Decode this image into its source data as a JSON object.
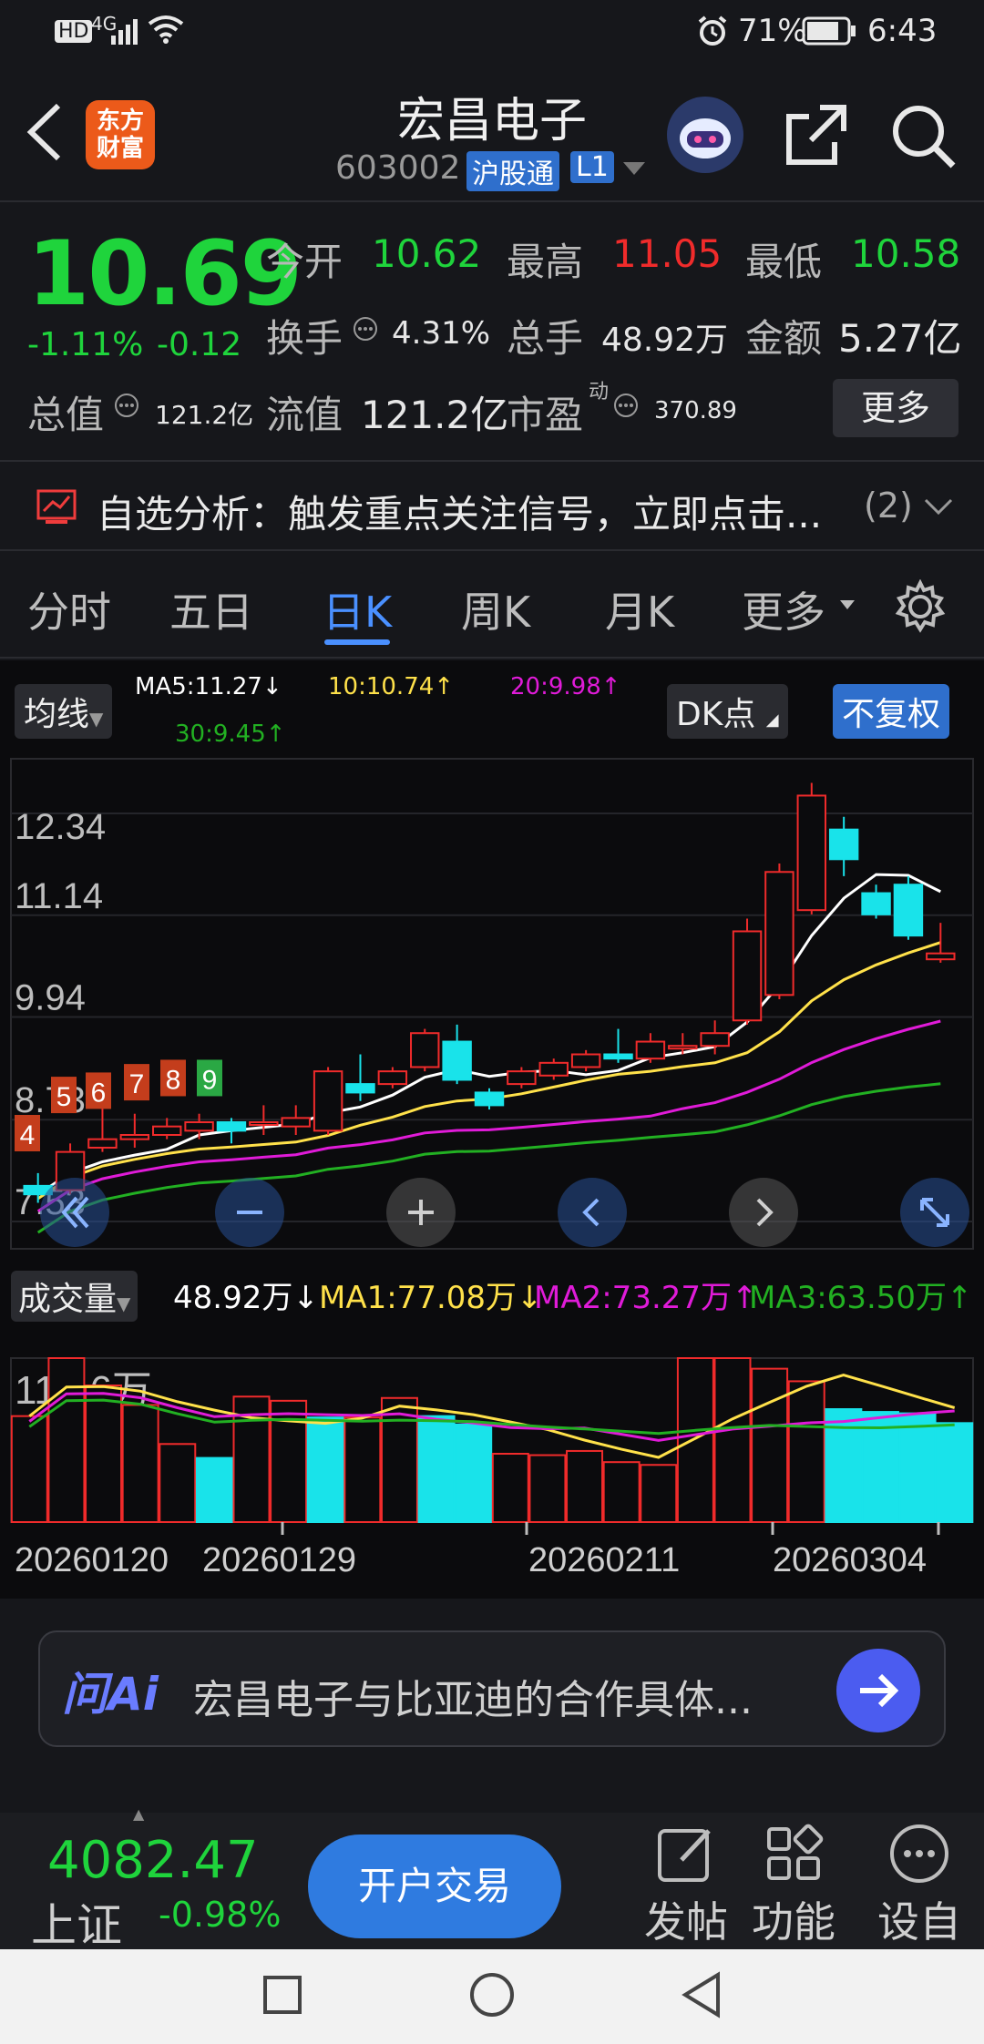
{
  "status": {
    "hd": "HD",
    "net": "4G",
    "battery": "71%",
    "time": "6:43"
  },
  "header": {
    "title": "宏昌电子",
    "code": "603002",
    "badge_connect": "沪股通",
    "badge_level": "L1",
    "logo_line1": "东方",
    "logo_line2": "财富"
  },
  "quote": {
    "price": "10.69",
    "change_pct": "-1.11%",
    "change_abs": "-0.12",
    "open_label": "今开",
    "open": "10.62",
    "high_label": "最高",
    "high": "11.05",
    "low_label": "最低",
    "low": "10.58",
    "turnover_label": "换手",
    "turnover": "4.31%",
    "volume_label": "总手",
    "volume": "48.92万",
    "amount_label": "金额",
    "amount": "5.27亿",
    "mcap_label": "总值",
    "mcap": "121.2亿",
    "float_label": "流值",
    "float": "121.2亿",
    "pe_label": "市盈",
    "pe_sup": "动",
    "pe": "370.89",
    "more": "更多"
  },
  "signal": {
    "text": "自选分析：触发重点关注信号，立即点击...",
    "count": "(2)"
  },
  "tabs": [
    "分时",
    "五日",
    "日K",
    "周K",
    "月K",
    "更多"
  ],
  "active_tab": 2,
  "ma": {
    "label": "均线",
    "ma5": "MA5:11.27↓",
    "ma10": "10:10.74↑",
    "ma20": "20:9.98↑",
    "ma30": "30:9.45↑",
    "dk": "DK点",
    "fq": "不复权"
  },
  "vol": {
    "label": "成交量",
    "v": "48.92万↓",
    "ma1": "MA1:77.08万↓",
    "ma2": "MA2:73.27万↑",
    "ma3": "MA3:63.50万↑"
  },
  "colors": {
    "up": "#f02b2b",
    "down": "#19e3ea",
    "ma5": "#ffffff",
    "ma10": "#ffe14a",
    "ma20": "#e01bd8",
    "ma30": "#22b022"
  },
  "chart_data": {
    "type": "candlestick",
    "price_ticks": [
      "12.34",
      "11.14",
      "9.94",
      "8.73",
      "7.53"
    ],
    "price_range": [
      7.53,
      12.34
    ],
    "volume_max_label": "117.6万",
    "volume_max": 117.6,
    "dates": [
      "20260120",
      "20260129",
      "20260211",
      "20260304"
    ],
    "markers": [
      "4",
      "5",
      "6",
      "7",
      "8",
      "9"
    ],
    "candles": [
      {
        "o": 7.95,
        "c": 7.85,
        "h": 8.1,
        "l": 7.75
      },
      {
        "o": 7.9,
        "c": 8.35,
        "h": 8.45,
        "l": 7.85
      },
      {
        "o": 8.4,
        "c": 8.5,
        "h": 8.9,
        "l": 8.35
      },
      {
        "o": 8.5,
        "c": 8.55,
        "h": 8.8,
        "l": 8.4
      },
      {
        "o": 8.55,
        "c": 8.65,
        "h": 8.75,
        "l": 8.5
      },
      {
        "o": 8.6,
        "c": 8.7,
        "h": 8.8,
        "l": 8.5
      },
      {
        "o": 8.7,
        "c": 8.6,
        "h": 8.75,
        "l": 8.45
      },
      {
        "o": 8.7,
        "c": 8.7,
        "h": 8.9,
        "l": 8.55
      },
      {
        "o": 8.65,
        "c": 8.75,
        "h": 8.9,
        "l": 8.55
      },
      {
        "o": 8.6,
        "c": 9.3,
        "h": 9.35,
        "l": 8.55
      },
      {
        "o": 9.15,
        "c": 9.05,
        "h": 9.5,
        "l": 8.95
      },
      {
        "o": 9.15,
        "c": 9.3,
        "h": 9.35,
        "l": 9.1
      },
      {
        "o": 9.35,
        "c": 9.75,
        "h": 9.8,
        "l": 9.3
      },
      {
        "o": 9.65,
        "c": 9.2,
        "h": 9.85,
        "l": 9.15
      },
      {
        "o": 9.05,
        "c": 8.9,
        "h": 9.1,
        "l": 8.85
      },
      {
        "o": 9.15,
        "c": 9.3,
        "h": 9.35,
        "l": 9.1
      },
      {
        "o": 9.25,
        "c": 9.4,
        "h": 9.45,
        "l": 9.2
      },
      {
        "o": 9.35,
        "c": 9.5,
        "h": 9.55,
        "l": 9.3
      },
      {
        "o": 9.5,
        "c": 9.45,
        "h": 9.8,
        "l": 9.4
      },
      {
        "o": 9.45,
        "c": 9.65,
        "h": 9.75,
        "l": 9.4
      },
      {
        "o": 9.6,
        "c": 9.6,
        "h": 9.75,
        "l": 9.5
      },
      {
        "o": 9.6,
        "c": 9.75,
        "h": 9.9,
        "l": 9.5
      },
      {
        "o": 9.9,
        "c": 10.95,
        "h": 11.1,
        "l": 9.85
      },
      {
        "o": 10.2,
        "c": 11.65,
        "h": 11.75,
        "l": 10.15
      },
      {
        "o": 11.2,
        "c": 12.55,
        "h": 12.7,
        "l": 11.15
      },
      {
        "o": 12.15,
        "c": 11.8,
        "h": 12.3,
        "l": 11.6
      },
      {
        "o": 11.4,
        "c": 11.15,
        "h": 11.5,
        "l": 11.1
      },
      {
        "o": 11.5,
        "c": 10.9,
        "h": 11.6,
        "l": 10.85
      },
      {
        "o": 10.62,
        "c": 10.69,
        "h": 11.05,
        "l": 10.58
      }
    ],
    "volumes": [
      76,
      117.6,
      98,
      84,
      56,
      46,
      90,
      87,
      75,
      75,
      89,
      76,
      70,
      49,
      48,
      51,
      43,
      41,
      117.6,
      117.6,
      110,
      101,
      81,
      79,
      78,
      71
    ],
    "vol_colors": [
      "up",
      "up",
      "up",
      "up",
      "up",
      "down",
      "up",
      "up",
      "down",
      "up",
      "up",
      "down",
      "down",
      "up",
      "up",
      "up",
      "up",
      "up",
      "up",
      "up",
      "up",
      "up",
      "down",
      "down",
      "down",
      "down"
    ]
  },
  "ask": {
    "brand": "问Ai",
    "text": "宏昌电子与比亚迪的合作具体..."
  },
  "index": {
    "value": "4082.47",
    "name": "上证",
    "chg": "-0.98%"
  },
  "bottom": {
    "trade": "开户交易",
    "post": "发帖",
    "func": "功能",
    "custom": "设自"
  }
}
